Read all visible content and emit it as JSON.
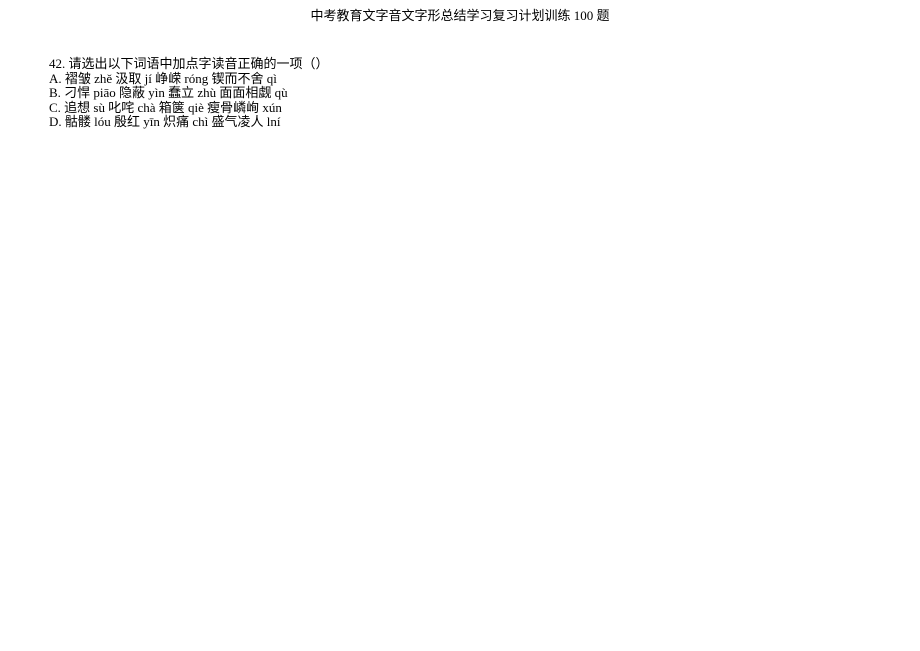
{
  "header": {
    "title": "中考教育文字音文字形总结学习复习计划训练 100 题"
  },
  "question": {
    "number_and_prompt": "42. 请选出以下词语中加点字读音正确的一项（）",
    "options": {
      "A": "A. 褶皱 zhě 汲取 jí 峥嵘 róng 锲而不舍 qì",
      "B": "B. 刁悍 piāo 隐蔽 yìn 蠢立 zhù 面面相觑 qù",
      "C": "C. 追想 sù 叱咤 chà 箱箧 qiè 瘦骨嶙峋 xún",
      "D": "D. 骷髅 lóu 殷红 yīn 炽痛 chì 盛气凌人 lní"
    }
  }
}
